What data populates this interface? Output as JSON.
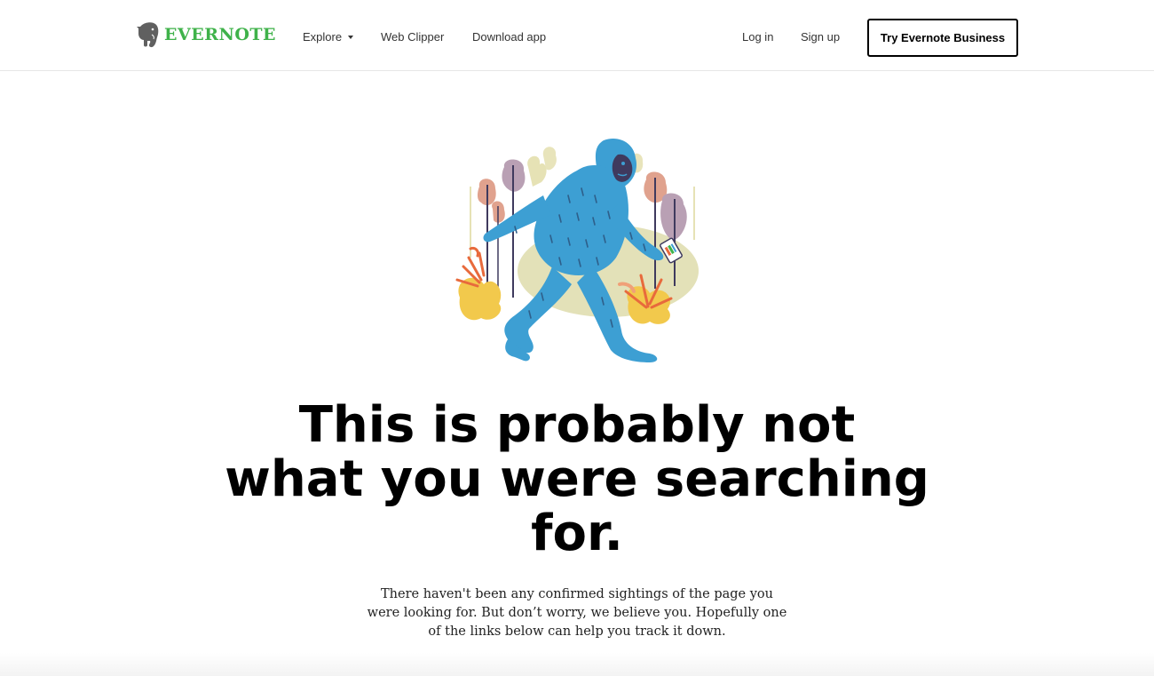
{
  "header": {
    "logo_text": "EVERNOTE",
    "nav": {
      "explore": "Explore",
      "web_clipper": "Web Clipper",
      "download_app": "Download app"
    },
    "auth": {
      "login": "Log in",
      "signup": "Sign up"
    },
    "cta": "Try Evernote Business"
  },
  "main": {
    "headline": "This is probably not what you were searching for.",
    "subtext": "There haven't been any confirmed sightings of the page you were looking for. But don’t worry, we believe you. Hopefully one of the links below can help you track it down."
  },
  "colors": {
    "brand_green": "#3fb24a",
    "bigfoot_blue": "#3d9fd3"
  },
  "icons": {
    "logo": "elephant-logo-icon",
    "explore_caret": "chevron-down-icon"
  }
}
